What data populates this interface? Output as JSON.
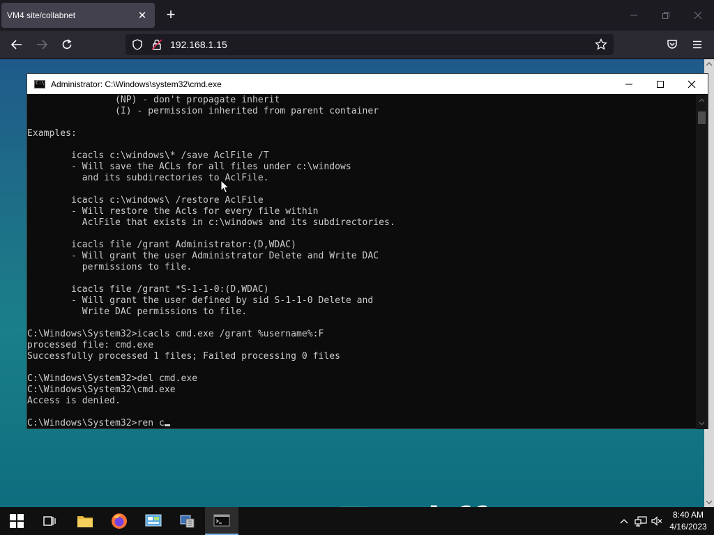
{
  "browser": {
    "tab_title": "VM4 site/collabnet",
    "url": "192.168.1.15"
  },
  "cmd": {
    "title": "Administrator: C:\\Windows\\system32\\cmd.exe",
    "lines": [
      "                (NP) - don't propagate inherit",
      "                (I) - permission inherited from parent container",
      "",
      "Examples:",
      "",
      "        icacls c:\\windows\\* /save AclFile /T",
      "        - Will save the ACLs for all files under c:\\windows",
      "          and its subdirectories to AclFile.",
      "",
      "        icacls c:\\windows\\ /restore AclFile",
      "        - Will restore the Acls for every file within",
      "          AclFile that exists in c:\\windows and its subdirectories.",
      "",
      "        icacls file /grant Administrator:(D,WDAC)",
      "        - Will grant the user Administrator Delete and Write DAC",
      "          permissions to file.",
      "",
      "        icacls file /grant *S-1-1-0:(D,WDAC)",
      "        - Will grant the user defined by sid S-1-1-0 Delete and",
      "          Write DAC permissions to file.",
      "",
      "C:\\Windows\\System32>icacls cmd.exe /grant %username%:F",
      "processed file: cmd.exe",
      "Successfully processed 1 files; Failed processing 0 files",
      "",
      "C:\\Windows\\System32>del cmd.exe",
      "C:\\Windows\\System32\\cmd.exe",
      "Access is denied.",
      ""
    ],
    "prompt_line": "C:\\Windows\\System32>ren c"
  },
  "desktop": {
    "decorative_text": "Tr ol  ff  t"
  },
  "taskbar": {
    "items": [
      "start-icon",
      "task-view-icon",
      "file-explorer-icon",
      "firefox-icon",
      "control-panel-icon",
      "server-manager-icon",
      "cmd-icon"
    ],
    "time": "8:40 AM",
    "date": "4/16/2023"
  },
  "colors": {
    "cmd_text": "#cccccc",
    "cmd_background": "#0c0c0c",
    "browser_tab": "#42414d",
    "taskbar": "#101010"
  }
}
